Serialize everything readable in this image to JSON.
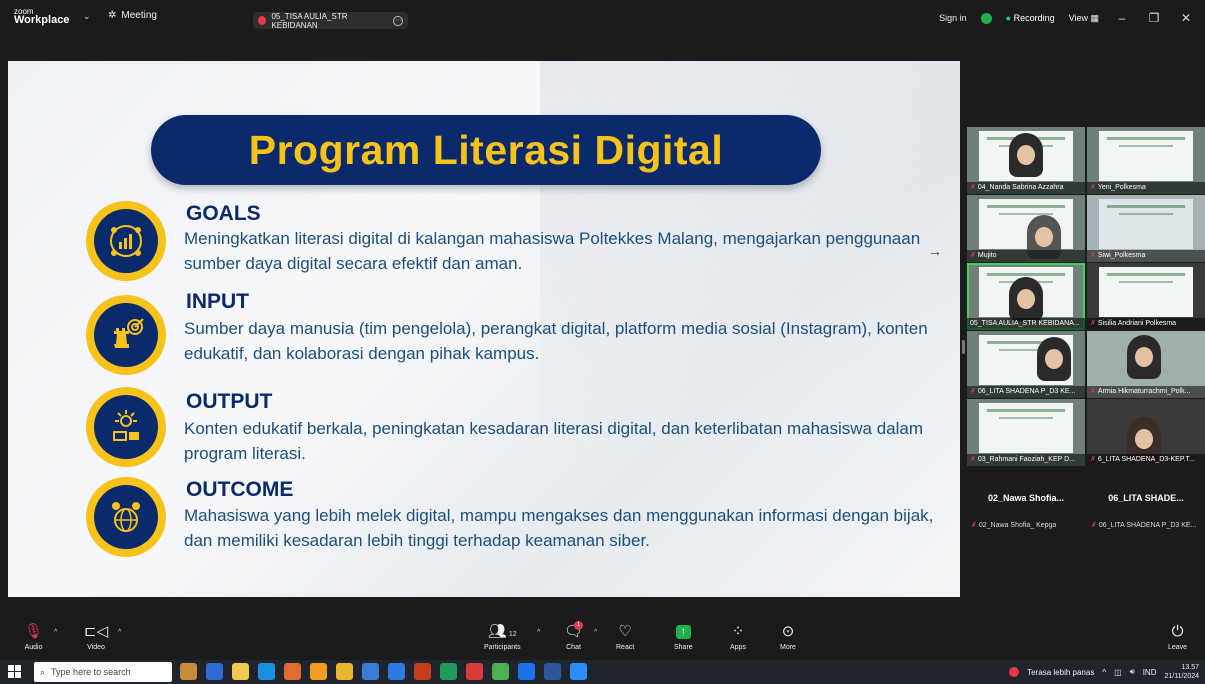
{
  "topbar": {
    "logo_small": "zoom",
    "logo_big": "Workplace",
    "meeting_label": "Meeting",
    "share_title": "05_TISA AULIA_STR KEBIDANAN",
    "sign_in": "Sign in",
    "recording": "Recording",
    "view": "View",
    "colors": {
      "recording_dot": "#23d05a",
      "shield": "#23b04a"
    }
  },
  "slide": {
    "title": "Program Literasi Digital",
    "sections": [
      {
        "heading": "GOALS",
        "body": "Meningkatkan literasi digital di kalangan mahasiswa Poltekkes Malang, mengajarkan penggunaan sumber daya digital secara efektif dan aman."
      },
      {
        "heading": "INPUT",
        "body": "Sumber daya manusia (tim pengelola), perangkat digital, platform media sosial (Instagram), konten edukatif, dan kolaborasi dengan pihak kampus."
      },
      {
        "heading": "OUTPUT",
        "body": "Konten edukatif berkala, peningkatan kesadaran literasi digital, dan keterlibatan mahasiswa dalam program literasi."
      },
      {
        "heading": "OUTCOME",
        "body": "Mahasiswa yang lebih melek digital, mampu mengakses dan menggunakan informasi dengan bijak, dan memiliki kesadaran lebih tinggi terhadap keamanan siber."
      }
    ],
    "colors": {
      "title_bg": "#0b2a6b",
      "title_text": "#f7c21a",
      "body_text": "#1d4f7a"
    }
  },
  "gallery": {
    "tiles": [
      {
        "name": "04_Nanda Sabrina Azzahra"
      },
      {
        "name": "Yeni_Polkesma"
      },
      {
        "name": "Mujito"
      },
      {
        "name": "Siwi_Polkesma"
      },
      {
        "name": "05_TISA AULIA_STR KEBIDANA..."
      },
      {
        "name": "Sisilia Andriani Polkesma"
      },
      {
        "name": "06_LITA SHADENA P_D3 KE..."
      },
      {
        "name": "Armia Hikmaturrachmi_Polk..."
      },
      {
        "name": "03_Rahmani Faoziah_KEP D..."
      },
      {
        "name": "6_LITA SHADENA_D3-KEP.T..."
      }
    ],
    "name_only": [
      {
        "title": "02_Nawa Shofia...",
        "sub": "02_Nawa Shofia_ Kepga"
      },
      {
        "title": "06_LITA SHADE...",
        "sub": "06_LITA SHADENA P_D3 KE..."
      }
    ]
  },
  "toolbar": {
    "audio": "Audio",
    "video": "Video",
    "participants": "Participants",
    "participants_count": "12",
    "chat": "Chat",
    "chat_badge": "1",
    "react": "React",
    "share": "Share",
    "apps": "Apps",
    "more": "More",
    "leave": "Leave"
  },
  "taskbar": {
    "search_placeholder": "Type here to search",
    "weather": "Terasa lebih panas",
    "lang": "IND",
    "time": "13.57",
    "date": "21/11/2024"
  }
}
